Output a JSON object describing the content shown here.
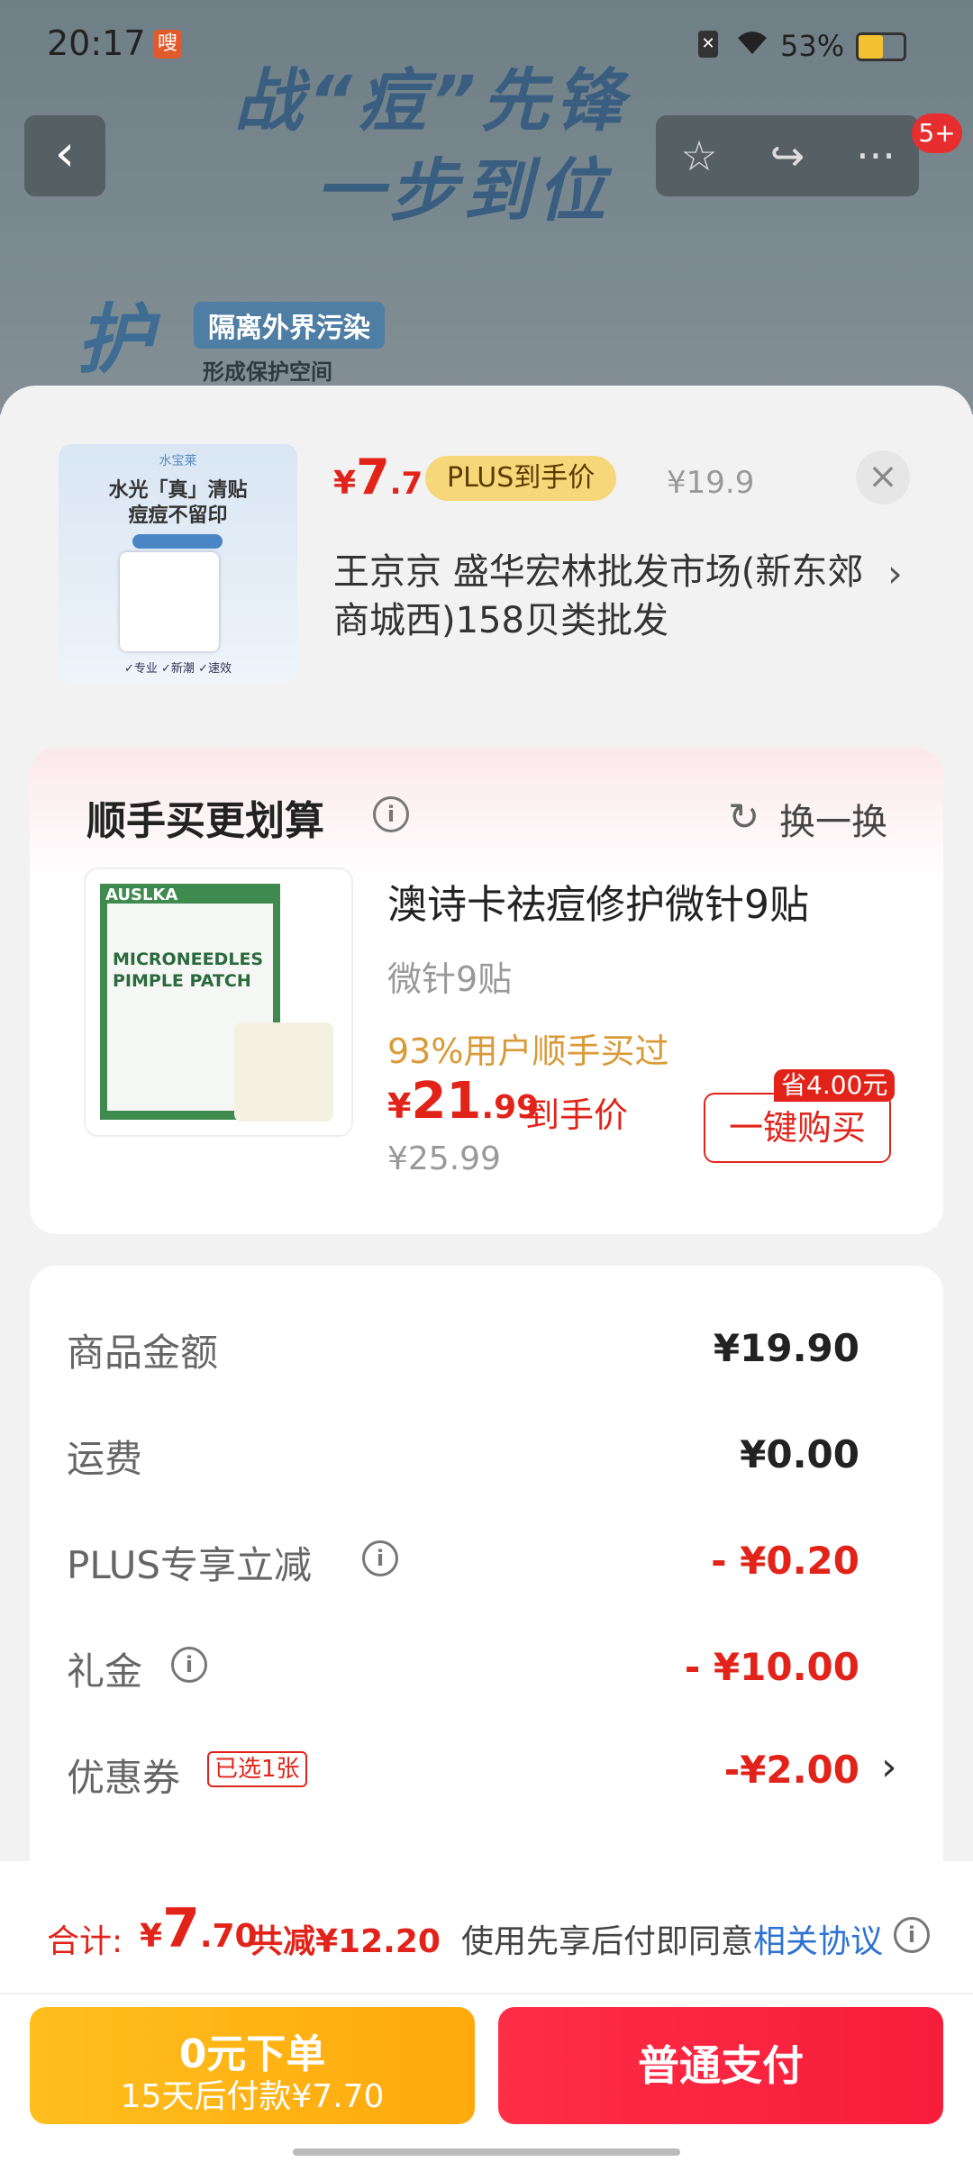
{
  "status_bar": {
    "time": "20:17",
    "notif_badge": "嗖",
    "sim_icon": "✕",
    "battery_percent": "53%",
    "battery_level": 0.53
  },
  "banner": {
    "line1": "战“痘”先锋",
    "line2": "一步到位",
    "protect_char": "护",
    "protect_tag": "隔离外界污染",
    "protect_sub": "形成保护空间"
  },
  "nav": {
    "back_icon": "‹",
    "favorite_icon": "☆",
    "share_icon": "↪",
    "more_icon": "···",
    "badge": "5+"
  },
  "product_header": {
    "thumb_brand": "水宝莱",
    "thumb_title": "水光「真」清贴\n痘痘不留印",
    "thumb_features": "✓专业  ✓新潮  ✓速效",
    "price_symbol": "¥",
    "price_int": "7",
    "price_dec": ".7",
    "plus_tag": "PLUS到手价",
    "original_price": "¥19.9",
    "close_icon": "×",
    "store_name": "王京京  盛华宏林批发市场(新东郊商城西)158贝类批发",
    "store_arrow": "›"
  },
  "upsell": {
    "title": "顺手买更划算",
    "info_icon": "i",
    "refresh_icon": "↻",
    "refresh_label": "换一换",
    "product_image_brand": "AUSLKA",
    "product_image_text": "MICRONEEDLES PIMPLE PATCH",
    "product_title": "澳诗卡祛痘修护微针9贴",
    "product_sub": "微针9贴",
    "stat": "93%用户顺手买过",
    "price_symbol": "¥",
    "price_int": "21",
    "price_dec": ".99",
    "price_label": "到手价",
    "original_price": "¥25.99",
    "save_tag": "省4.00元",
    "buy_button": "一键购买"
  },
  "summary": {
    "rows": [
      {
        "label": "商品金额",
        "value": "¥19.90"
      },
      {
        "label": "运费",
        "value": "¥0.00"
      },
      {
        "label": "PLUS专享立减",
        "value": "- ¥0.20"
      },
      {
        "label": "礼金",
        "value": "- ¥10.00"
      },
      {
        "label": "优惠券",
        "value": "-¥2.00"
      }
    ],
    "coupon_tag": "已选1张",
    "coupon_arrow": "›",
    "info_icon": "i"
  },
  "footer": {
    "total_label": "合计:",
    "total_symbol": "¥",
    "total_int": "7",
    "total_dec": ".70",
    "total_saved": "共减¥12.20",
    "agree_text": "使用先享后付即同意",
    "agree_link": "相关协议",
    "info_icon": "i",
    "later_line1": "0元下单",
    "later_line2": "15天后付款¥7.70",
    "pay_button": "普通支付"
  },
  "colors": {
    "accent_red": "#e2231a",
    "later_yellow": "#ffb414",
    "pay_red": "#f6253f",
    "link_blue": "#2e72d2"
  }
}
